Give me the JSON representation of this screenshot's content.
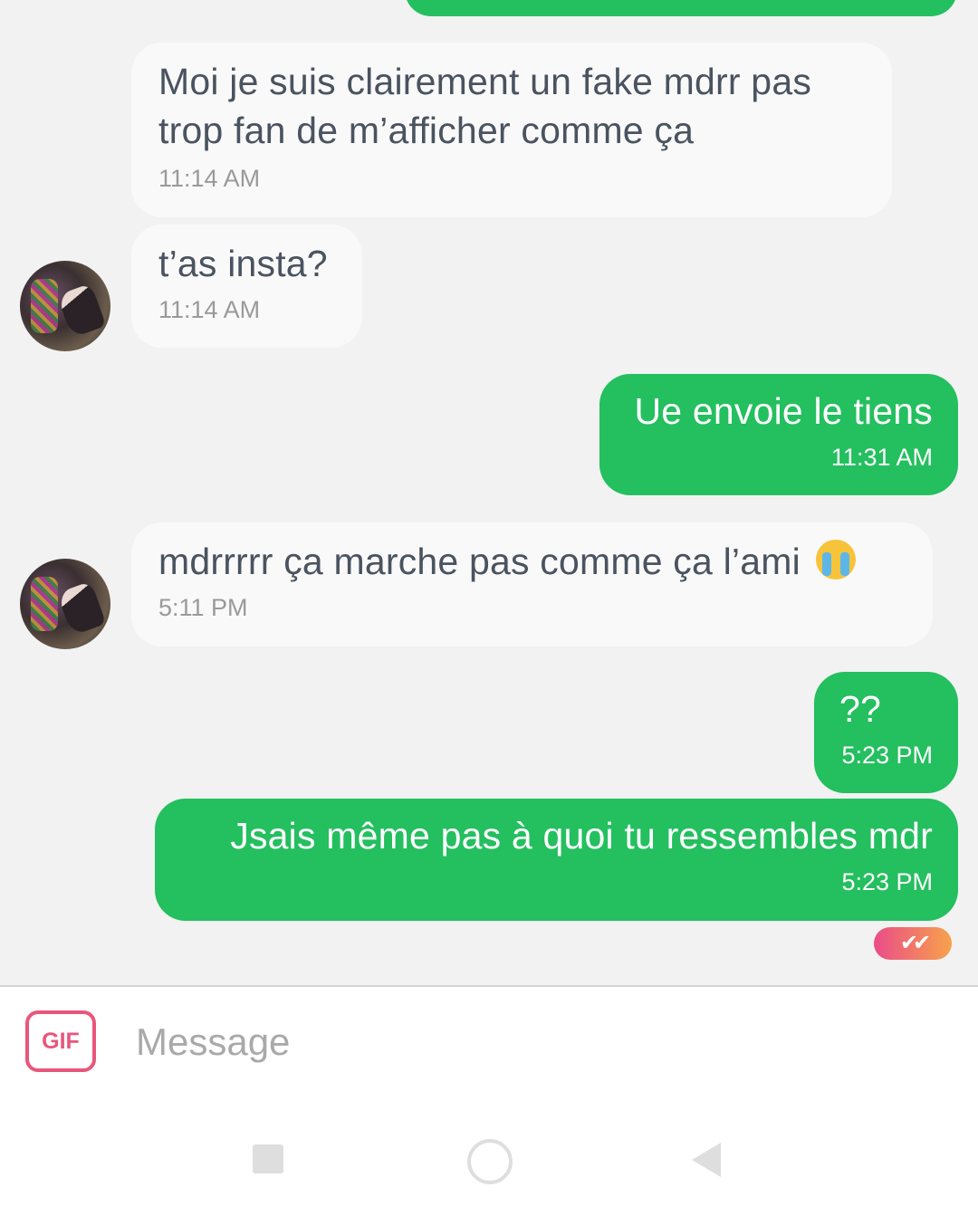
{
  "messages": [
    {
      "direction": "outgoing",
      "text": "",
      "time": ""
    },
    {
      "direction": "incoming",
      "text": "Moi je suis clairement un fake mdrr pas trop fan de m’afficher comme ça",
      "time": "11:14 AM"
    },
    {
      "direction": "incoming",
      "text": "t’as insta?",
      "time": "11:14 AM"
    },
    {
      "direction": "outgoing",
      "text": "Ue envoie le tiens",
      "time": "11:31 AM"
    },
    {
      "direction": "incoming",
      "text": "mdrrrrr ça marche pas comme ça l’ami",
      "time": "5:11 PM",
      "emoji": "loudly-crying-face-emoji"
    },
    {
      "direction": "outgoing",
      "text": "??",
      "time": "5:23 PM"
    },
    {
      "direction": "outgoing",
      "text": "Jsais même pas à quoi tu ressembles mdr",
      "time": "5:23 PM"
    }
  ],
  "read_receipt": {
    "icon": "double-check-icon",
    "glyph": "✔✔"
  },
  "composer": {
    "gif_label": "GIF",
    "placeholder": "Message"
  },
  "navbar": {
    "icons": [
      "recent-apps-icon",
      "home-icon",
      "back-icon"
    ]
  },
  "colors": {
    "outgoing_bubble": "#24bf5f",
    "incoming_bubble": "#f9f9f9",
    "background": "#f2f2f2",
    "gif_accent": "#e9567c"
  }
}
